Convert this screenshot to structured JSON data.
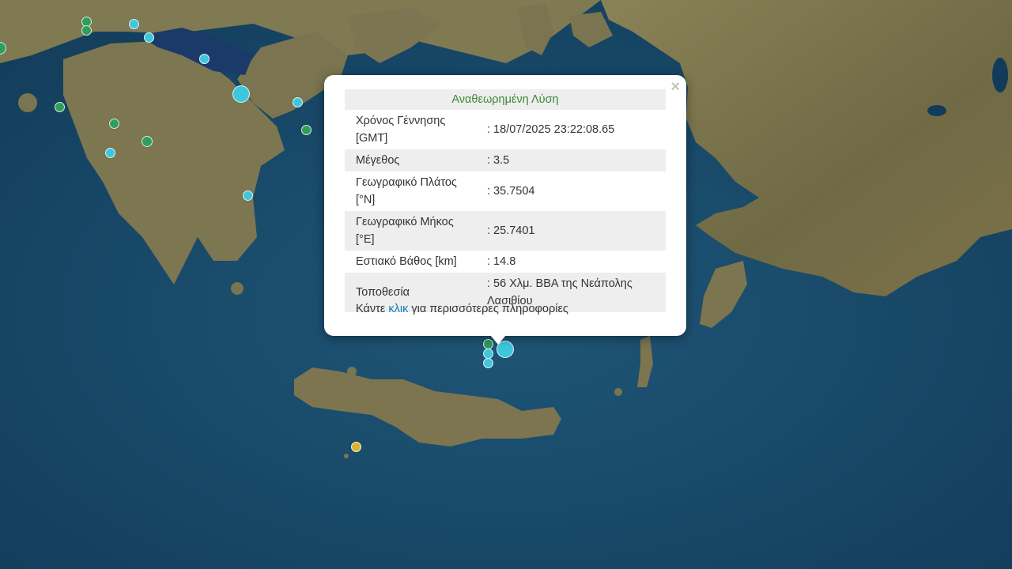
{
  "popup": {
    "title": "Αναθεωρημένη Λύση",
    "close_label": "×",
    "rows": [
      {
        "label": "Χρόνος Γέννησης [GMT]",
        "value": ": 18/07/2025 23:22:08.65"
      },
      {
        "label": "Μέγεθος",
        "value": ": 3.5"
      },
      {
        "label": "Γεωγραφικό Πλάτος [°N]",
        "value": ": 35.7504"
      },
      {
        "label": "Γεωγραφικό Μήκος [°E]",
        "value": ": 25.7401"
      },
      {
        "label": "Εστιακό Βάθος [km]",
        "value": ": 14.8"
      },
      {
        "label": "Τοποθεσία",
        "value": ": 56 Χλμ. ΒΒΑ της Νεάπολης Λασιθίου"
      }
    ],
    "more_prefix": "Κάντε ",
    "more_link": "κλικ",
    "more_suffix": " για περισσότερες πληροφορίες"
  },
  "colors": {
    "sea": "#17486a",
    "land": "#7a7350",
    "marker_cyan": "#3fc6df",
    "marker_green": "#2e9e5a",
    "marker_yellow": "#d9b52c"
  }
}
